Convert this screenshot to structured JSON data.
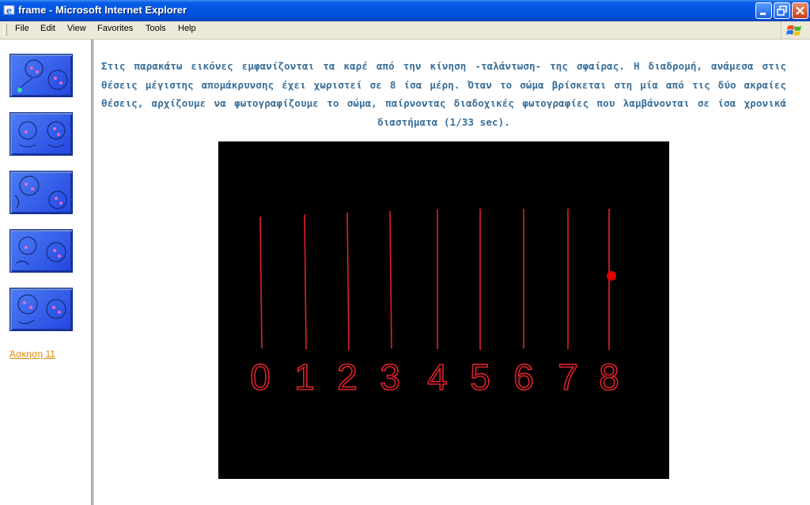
{
  "window": {
    "title": "frame - Microsoft Internet Explorer",
    "icons": {
      "app": "ie-icon",
      "minimize": "minimize-icon",
      "maximize": "restore-icon",
      "close": "close-icon"
    }
  },
  "menu": {
    "items": [
      "File",
      "Edit",
      "View",
      "Favorites",
      "Tools",
      "Help"
    ]
  },
  "sidebar": {
    "thumbnails": [
      "animation-thumbnail",
      "animation-thumbnail",
      "animation-thumbnail",
      "animation-thumbnail",
      "animation-thumbnail"
    ],
    "link_label": "Άσκηση 11"
  },
  "main": {
    "description": "Στις παρακάτω εικόνες εμφανίζονται τα καρέ από την κίνηση -ταλάντωση- της σφαίρας. Η διαδρομή, ανάμεσα στις θέσεις μέγιστης απομάκρυνσης έχει χωριστεί σε  8 ίσα μέρη.  Όταν το σώμα βρίσκεται στη μία από τις δύο ακραίες θέσεις, αρχίζουμε να φωτογραφίζουμε το σώμα, παίρνοντας διαδοχικές φωτογραφίες που λαμβάνονται σε ίσα χρονικά διαστήματα (1/33 sec).",
    "frames": {
      "labels": [
        "0",
        "1",
        "2",
        "3",
        "4",
        "5",
        "6",
        "7",
        "8"
      ],
      "ball_position": "8",
      "line_color": "#e0202a",
      "ball_color": "#e00000"
    }
  }
}
